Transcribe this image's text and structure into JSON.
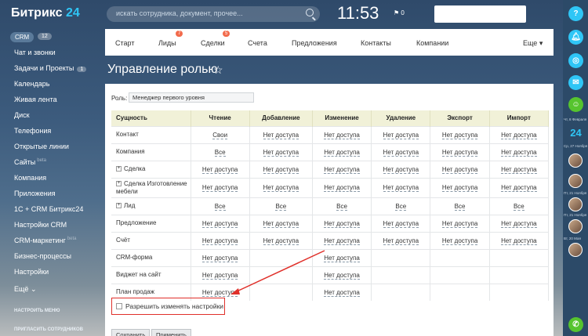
{
  "header": {
    "logo_text": "Битрикс",
    "logo_num": "24",
    "search_placeholder": "искать сотрудника, документ, прочее...",
    "clock": "11:53",
    "flag": "0"
  },
  "leftmenu": {
    "crm_label": "CRM",
    "crm_count": "12",
    "items": [
      {
        "label": "Чат и звонки"
      },
      {
        "label": "Задачи и Проекты",
        "count": "1"
      },
      {
        "label": "Календарь"
      },
      {
        "label": "Живая лента"
      },
      {
        "label": "Диск"
      },
      {
        "label": "Телефония"
      },
      {
        "label": "Открытые линии"
      },
      {
        "label": "Сайты",
        "beta": "beta"
      },
      {
        "label": "Компания"
      },
      {
        "label": "Приложения"
      },
      {
        "label": "1С + CRM Битрикс24"
      },
      {
        "label": "Настройки CRM"
      },
      {
        "label": "CRM-маркетинг",
        "beta": "beta"
      },
      {
        "label": "Бизнес-процессы"
      },
      {
        "label": "Настройки"
      },
      {
        "label": "Ещё"
      }
    ],
    "setup_menu": "НАСТРОИТЬ МЕНЮ",
    "invite": "ПРИГЛАСИТЬ СОТРУДНИКОВ"
  },
  "nav": {
    "items": [
      {
        "label": "Старт"
      },
      {
        "label": "Лиды",
        "badge": "7"
      },
      {
        "label": "Сделки",
        "badge": "5"
      },
      {
        "label": "Счета"
      },
      {
        "label": "Предложения"
      },
      {
        "label": "Контакты"
      },
      {
        "label": "Компании"
      },
      {
        "label": "Еще"
      }
    ]
  },
  "page": {
    "title": "Управление ролью",
    "role_label": "Роль:",
    "role_value": "Менеджер первого уровня",
    "columns": [
      "Сущность",
      "Чтение",
      "Добавление",
      "Изменение",
      "Удаление",
      "Экспорт",
      "Импорт"
    ],
    "rows": [
      {
        "entity": "Контакт",
        "cells": [
          "Свои",
          "Нет доступа",
          "Нет доступа",
          "Нет доступа",
          "Нет доступа",
          "Нет доступа"
        ]
      },
      {
        "entity": "Компания",
        "cells": [
          "Все",
          "Нет доступа",
          "Нет доступа",
          "Нет доступа",
          "Нет доступа",
          "Нет доступа"
        ]
      },
      {
        "entity": "Сделка",
        "expand": true,
        "cells": [
          "Нет доступа",
          "Нет доступа",
          "Нет доступа",
          "Нет доступа",
          "Нет доступа",
          "Нет доступа"
        ]
      },
      {
        "entity": "Сделка Изготовление мебели",
        "expand": true,
        "cells": [
          "Нет доступа",
          "Нет доступа",
          "Нет доступа",
          "Нет доступа",
          "Нет доступа",
          "Нет доступа"
        ]
      },
      {
        "entity": "Лид",
        "expand": true,
        "cells": [
          "Все",
          "Все",
          "Все",
          "Все",
          "Все",
          "Все"
        ]
      },
      {
        "entity": "Предложение",
        "cells": [
          "Нет доступа",
          "Нет доступа",
          "Нет доступа",
          "Нет доступа",
          "Нет доступа",
          "Нет доступа"
        ]
      },
      {
        "entity": "Счёт",
        "cells": [
          "Нет доступа",
          "Нет доступа",
          "Нет доступа",
          "Нет доступа",
          "Нет доступа",
          "Нет доступа"
        ]
      },
      {
        "entity": "CRM-форма",
        "cells": [
          "Нет доступа",
          "",
          "Нет доступа",
          "",
          "",
          ""
        ]
      },
      {
        "entity": "Виджет на сайт",
        "cells": [
          "Нет доступа",
          "",
          "Нет доступа",
          "",
          "",
          ""
        ]
      },
      {
        "entity": "План продаж",
        "cells": [
          "Нет доступа",
          "",
          "Нет доступа",
          "",
          "",
          ""
        ]
      }
    ],
    "checkbox_label": "Разрешить изменять настройки",
    "save_button": "Сохранить",
    "apply_button": "Применить"
  },
  "rightbar": {
    "help": "?",
    "date1": "Чт, 8 Февраля",
    "date2": "Ср, 27 Ноября",
    "date3": "Пт, 21 Ноября",
    "date4": "Пт, 21 Ноября",
    "date5": "Вт, 20 Мая",
    "logo24": "24"
  },
  "colors": {
    "accent": "#2fc6f6",
    "badge": "#f26b4c",
    "highlight_border": "#e0302a",
    "table_header": "#f1f1d8"
  }
}
